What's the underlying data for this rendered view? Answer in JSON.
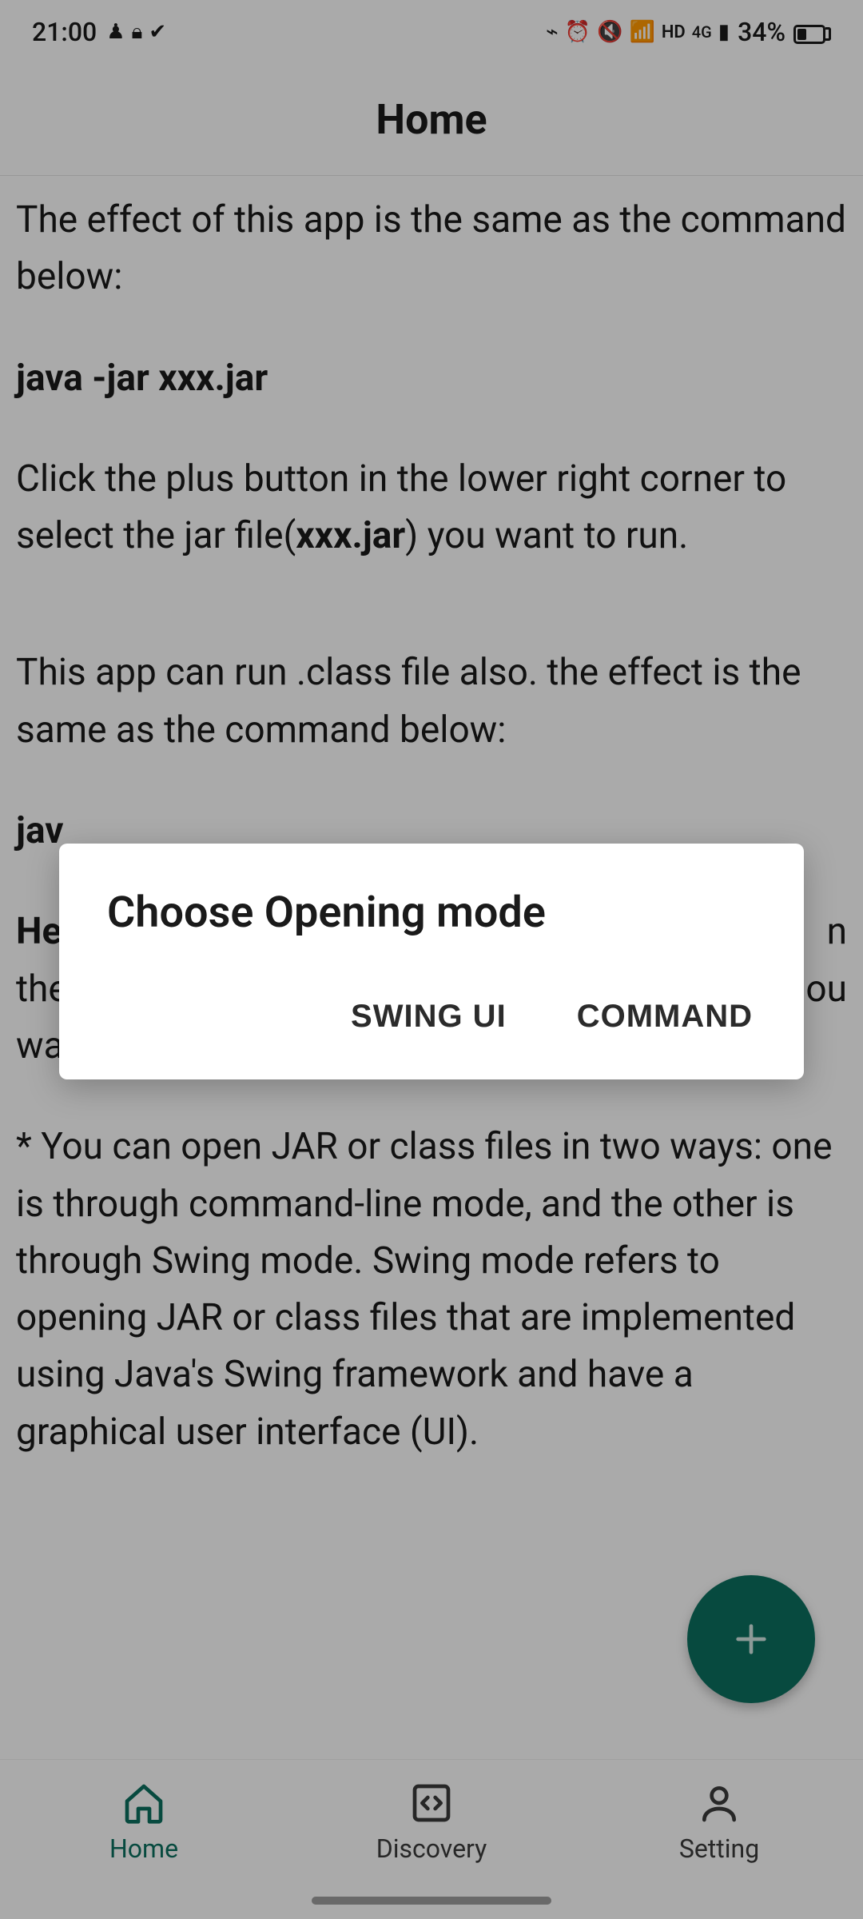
{
  "status_bar": {
    "time": "21:00",
    "battery_pct": "34%"
  },
  "header": {
    "title": "Home"
  },
  "content": {
    "p1": "The effect of this app is the same as the command below:",
    "cmd1": "java -jar xxx.jar",
    "p2a": "Click the plus button in the lower right corner to select the jar file(",
    "p2b": "xxx.jar",
    "p2c": ") you want to run.",
    "p3": "This app can run .class file also. the effect is the same as the command below:",
    "cmd2_prefix": "jav",
    "p4_prefix": "He",
    "p4_line2_prefix": "the",
    "p4_right_frag1": "n",
    "p4_right_frag2": "ou",
    "p4_line3": "want to run.",
    "p5": "* You can open JAR or class files in two ways: one is through command-line mode, and the other is through Swing mode. Swing mode refers to opening JAR or class files that are implemented using Java's Swing framework and have a graphical user interface (UI)."
  },
  "dialog": {
    "title": "Choose Opening mode",
    "swing": "SWING UI",
    "command": "COMMAND"
  },
  "bottom_nav": {
    "home": "Home",
    "discovery": "Discovery",
    "setting": "Setting"
  }
}
